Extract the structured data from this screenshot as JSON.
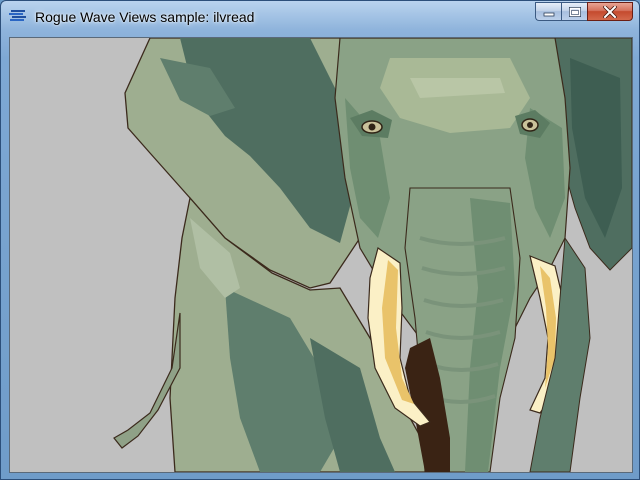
{
  "window": {
    "title": "Rogue Wave Views sample: ilvread",
    "app_icon": "rogue-wave-views-app-icon"
  },
  "caption_buttons": {
    "minimize_icon": "minimize-icon",
    "maximize_icon": "maximize-icon",
    "close_icon": "close-icon"
  },
  "canvas": {
    "background_color": "#c0c0c0",
    "image_subject": "elephant-illustration",
    "colors": {
      "skin_light": "#9eae90",
      "skin_mid": "#7f9a7d",
      "skin_dark": "#4f6e60",
      "skin_darkest": "#3e5e52",
      "tusk": "#fbf0c6",
      "tusk_shade": "#e9c36a",
      "mouth": "#3a2314",
      "outline": "#3b2a1c"
    }
  }
}
